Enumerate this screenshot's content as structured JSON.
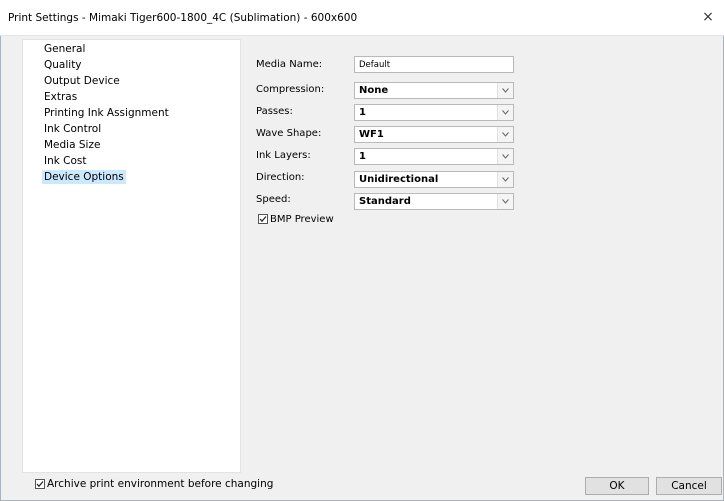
{
  "window": {
    "title": "Print Settings - Mimaki Tiger600-1800_4C (Sublimation) - 600x600",
    "close_glyph": "×"
  },
  "sidebar": {
    "items": [
      {
        "label": "General"
      },
      {
        "label": "Quality"
      },
      {
        "label": "Output Device"
      },
      {
        "label": "Extras"
      },
      {
        "label": "Printing Ink Assignment"
      },
      {
        "label": "Ink Control"
      },
      {
        "label": "Media Size"
      },
      {
        "label": "Ink Cost"
      },
      {
        "label": "Device Options",
        "selected": true
      }
    ]
  },
  "options": {
    "media_name": {
      "label": "Media Name:",
      "value": "Default"
    },
    "compression": {
      "label": "Compression:",
      "value": "None"
    },
    "passes": {
      "label": "Passes:",
      "value": "1"
    },
    "wave_shape": {
      "label": "Wave Shape:",
      "value": "WF1"
    },
    "ink_layers": {
      "label": "Ink Layers:",
      "value": "1"
    },
    "direction": {
      "label": "Direction:",
      "value": "Unidirectional"
    },
    "speed": {
      "label": "Speed:",
      "value": "Standard"
    },
    "bmp_preview": {
      "label": "BMP Preview",
      "checked": true
    }
  },
  "footer": {
    "archive_checkbox": {
      "label": "Archive print environment before changing",
      "checked": true
    },
    "ok_label": "OK",
    "cancel_label": "Cancel"
  },
  "colors": {
    "selection": "#cce8ff",
    "dialog_background": "#f0f0f0"
  }
}
